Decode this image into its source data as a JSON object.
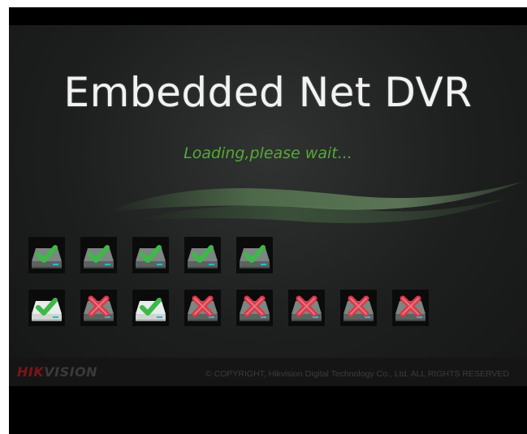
{
  "splash": {
    "title": "Embedded Net DVR",
    "loading_text": "Loading,please wait..."
  },
  "disk_rows": [
    [
      "ok-active",
      "ok-active",
      "ok-active",
      "ok-active",
      "ok-active"
    ],
    [
      "ok",
      "error",
      "ok",
      "error",
      "error",
      "error",
      "error",
      "error"
    ]
  ],
  "footer": {
    "logo_part1": "HIK",
    "logo_part2": "VISION",
    "copyright": "© COPYRIGHT, Hikvision Digital Technology Co., Ltd. ALL RIGHTS RESERVED"
  },
  "colors": {
    "check_green": "#3fb84a",
    "error_red": "#d93a4a",
    "loading_green": "#58a83a",
    "logo_red": "#7b1616"
  }
}
